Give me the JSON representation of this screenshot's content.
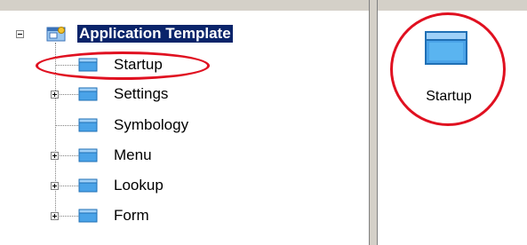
{
  "tree": {
    "root": {
      "label": "Application Template",
      "icon": "app-template-icon",
      "expanded": true
    },
    "items": [
      {
        "label": "Startup",
        "icon": "folder-icon",
        "expandable": false
      },
      {
        "label": "Settings",
        "icon": "folder-icon",
        "expandable": true
      },
      {
        "label": "Symbology",
        "icon": "folder-icon",
        "expandable": false
      },
      {
        "label": "Menu",
        "icon": "folder-icon",
        "expandable": true
      },
      {
        "label": "Lookup",
        "icon": "folder-icon",
        "expandable": true
      },
      {
        "label": "Form",
        "icon": "folder-icon",
        "expandable": true
      }
    ]
  },
  "list_view": {
    "items": [
      {
        "label": "Startup",
        "icon": "folder-icon"
      }
    ]
  },
  "colors": {
    "selection": "#0a246a",
    "annotation": "#e01020",
    "folder": "#4aa3e8",
    "chrome": "#d4d0c8"
  }
}
